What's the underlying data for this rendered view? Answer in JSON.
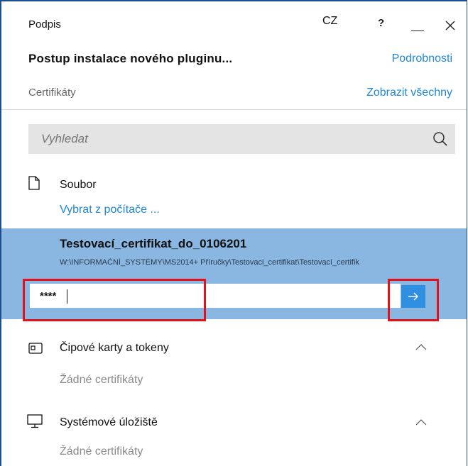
{
  "window": {
    "title": "Podpis",
    "language": "CZ",
    "help_label": "?"
  },
  "header": {
    "heading": "Postup instalace nového pluginu...",
    "details_link": "Podrobnosti"
  },
  "certificates": {
    "label": "Certifikáty",
    "show_all_link": "Zobrazit všechny"
  },
  "search": {
    "placeholder": "Vyhledat",
    "value": ""
  },
  "file_section": {
    "label": "Soubor",
    "choose_link": "Vybrat z počítače ..."
  },
  "selected_certificate": {
    "name": "Testovací_certifikat_do_0106201",
    "path": "W:\\INFORMAČNÍ_SYSTÉMY\\MS2014+ Příručky\\Testovaci_certifikat\\Testovací_certifik",
    "password_value": "****"
  },
  "smart_cards": {
    "label": "Čipové karty a tokeny",
    "empty_text": "Žádné certifikáty"
  },
  "system_store": {
    "label": "Systémové úložiště",
    "empty_text": "Žádné certifikáty"
  },
  "icons": {
    "search": "search-icon",
    "file": "file-icon",
    "chip": "chip-card-icon",
    "monitor": "monitor-icon",
    "submit": "arrow-right-icon",
    "chevron": "chevron-up-icon",
    "close": "close-icon",
    "minimize": "minimize-icon"
  },
  "colors": {
    "accent": "#1e88d8",
    "selection": "#8ab7e2",
    "submit_button": "#2f8fe0",
    "highlight": "#e4101a",
    "search_bg": "#e4e4e4"
  }
}
